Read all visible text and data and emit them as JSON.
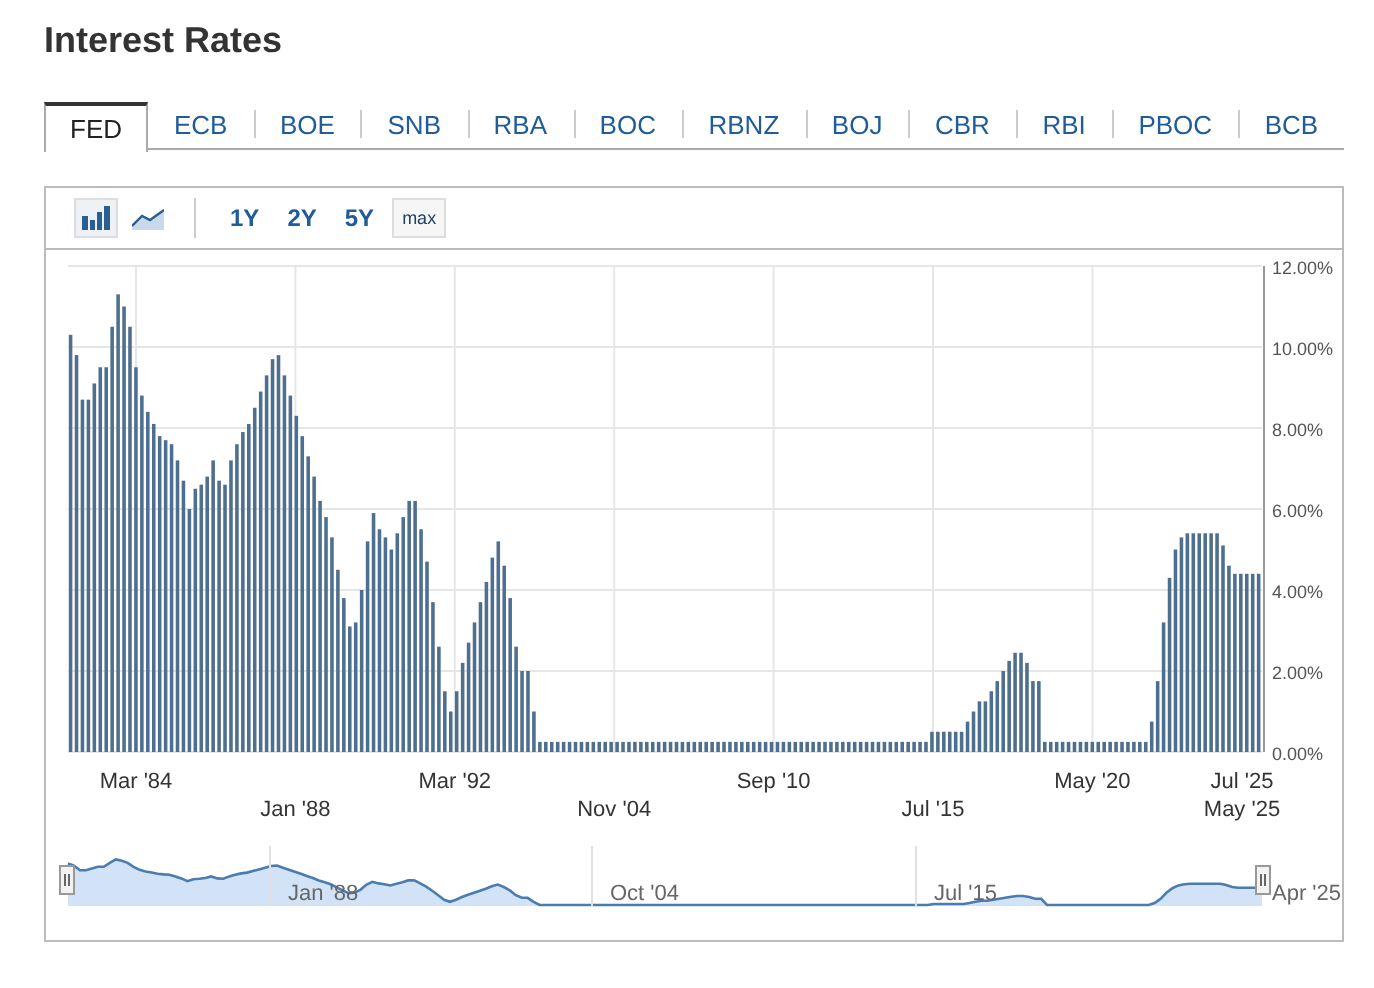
{
  "title": "Interest Rates",
  "tabs": [
    {
      "label": "FED",
      "selected": true
    },
    {
      "label": "ECB",
      "selected": false
    },
    {
      "label": "BOE",
      "selected": false
    },
    {
      "label": "SNB",
      "selected": false
    },
    {
      "label": "RBA",
      "selected": false
    },
    {
      "label": "BOC",
      "selected": false
    },
    {
      "label": "RBNZ",
      "selected": false
    },
    {
      "label": "BOJ",
      "selected": false
    },
    {
      "label": "CBR",
      "selected": false
    },
    {
      "label": "RBI",
      "selected": false
    },
    {
      "label": "PBOC",
      "selected": false
    },
    {
      "label": "BCB",
      "selected": false
    }
  ],
  "chart_types": [
    {
      "kind": "bar",
      "selected": true
    },
    {
      "kind": "area",
      "selected": false
    }
  ],
  "ranges": [
    {
      "label": "1Y",
      "selected": false
    },
    {
      "label": "2Y",
      "selected": false
    },
    {
      "label": "5Y",
      "selected": false
    },
    {
      "label": "max",
      "selected": true
    }
  ],
  "chart_data": {
    "type": "bar",
    "ylim": [
      0,
      12
    ],
    "yticks": [
      {
        "value": 0,
        "label": "0.00%"
      },
      {
        "value": 2,
        "label": "2.00%"
      },
      {
        "value": 4,
        "label": "4.00%"
      },
      {
        "value": 6,
        "label": "6.00%"
      },
      {
        "value": 8,
        "label": "8.00%"
      },
      {
        "value": 10,
        "label": "10.00%"
      },
      {
        "value": 12,
        "label": "12.00%"
      }
    ],
    "grid": true,
    "series": [
      {
        "color": "#4f6f8f",
        "values": [
          10.3,
          9.8,
          8.7,
          8.7,
          9.1,
          9.5,
          9.5,
          10.5,
          11.3,
          11.0,
          10.5,
          9.5,
          8.8,
          8.4,
          8.1,
          7.8,
          7.7,
          7.6,
          7.2,
          6.7,
          6.0,
          6.5,
          6.6,
          6.8,
          7.2,
          6.7,
          6.6,
          7.2,
          7.6,
          7.9,
          8.1,
          8.5,
          8.9,
          9.3,
          9.7,
          9.8,
          9.3,
          8.8,
          8.3,
          7.8,
          7.3,
          6.8,
          6.2,
          5.8,
          5.3,
          4.5,
          3.8,
          3.1,
          3.2,
          4.0,
          5.2,
          5.9,
          5.5,
          5.3,
          5.0,
          5.4,
          5.8,
          6.2,
          6.2,
          5.5,
          4.7,
          3.7,
          2.6,
          1.5,
          1.0,
          1.5,
          2.2,
          2.7,
          3.2,
          3.7,
          4.2,
          4.8,
          5.2,
          4.6,
          3.8,
          2.6,
          2.0,
          2.0,
          1.0,
          0.25,
          0.25,
          0.25,
          0.25,
          0.25,
          0.25,
          0.25,
          0.25,
          0.25,
          0.25,
          0.25,
          0.25,
          0.25,
          0.25,
          0.25,
          0.25,
          0.25,
          0.25,
          0.25,
          0.25,
          0.25,
          0.25,
          0.25,
          0.25,
          0.25,
          0.25,
          0.25,
          0.25,
          0.25,
          0.25,
          0.25,
          0.25,
          0.25,
          0.25,
          0.25,
          0.25,
          0.25,
          0.25,
          0.25,
          0.25,
          0.25,
          0.25,
          0.25,
          0.25,
          0.25,
          0.25,
          0.25,
          0.25,
          0.25,
          0.25,
          0.25,
          0.25,
          0.25,
          0.25,
          0.25,
          0.25,
          0.25,
          0.25,
          0.25,
          0.25,
          0.25,
          0.25,
          0.25,
          0.25,
          0.25,
          0.25,
          0.5,
          0.5,
          0.5,
          0.5,
          0.5,
          0.5,
          0.75,
          1.0,
          1.25,
          1.25,
          1.5,
          1.75,
          2.0,
          2.25,
          2.45,
          2.45,
          2.2,
          1.75,
          1.75,
          0.25,
          0.25,
          0.25,
          0.25,
          0.25,
          0.25,
          0.25,
          0.25,
          0.25,
          0.25,
          0.25,
          0.25,
          0.25,
          0.25,
          0.25,
          0.25,
          0.25,
          0.25,
          0.75,
          1.75,
          3.2,
          4.3,
          5.0,
          5.3,
          5.4,
          5.4,
          5.4,
          5.4,
          5.4,
          5.4,
          5.1,
          4.6,
          4.4,
          4.4,
          4.4,
          4.4,
          4.4
        ]
      }
    ]
  },
  "x_axis_labels": {
    "top_row": [
      "Mar '84",
      "Mar '92",
      "Sep '10",
      "May '20",
      "Jul '25"
    ],
    "bottom_row": [
      "Jan '88",
      "Nov '04",
      "Jul '15",
      "May '25"
    ]
  },
  "navigator": {
    "labels": [
      "Jan '88",
      "Oct '04",
      "Jul '15",
      "Apr '25"
    ]
  }
}
